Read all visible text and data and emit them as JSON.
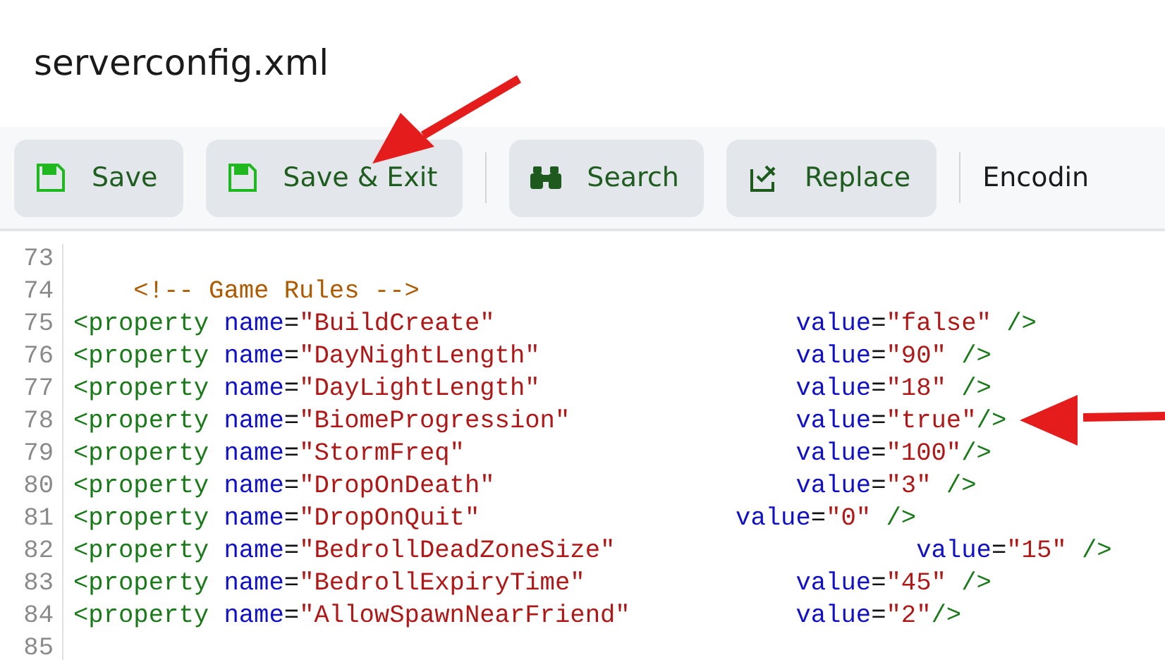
{
  "window": {
    "title": "serverconfig.xml"
  },
  "toolbar": {
    "buttons": [
      {
        "kind": "save",
        "label": "Save"
      },
      {
        "kind": "save",
        "label": "Save & Exit"
      },
      {
        "kind": "separator"
      },
      {
        "kind": "search",
        "label": "Search"
      },
      {
        "kind": "replace",
        "label": "Replace"
      },
      {
        "kind": "separator"
      },
      {
        "kind": "text",
        "label": "Encodin"
      }
    ]
  },
  "editor": {
    "lines": [
      {
        "number": "73"
      },
      {
        "number": "74",
        "tokens": [
          {
            "kind": "comment",
            "text": "    <!-- Game Rules -->"
          }
        ]
      },
      {
        "number": "75",
        "tokens": [
          {
            "kind": "tag",
            "text": "<property"
          },
          {
            "kind": "attr",
            "text": " name"
          },
          {
            "kind": "punct",
            "text": "="
          },
          {
            "kind": "string",
            "text": "\"BuildCreate\""
          },
          {
            "kind": "attr",
            "text": "                    value"
          },
          {
            "kind": "punct",
            "text": "="
          },
          {
            "kind": "string",
            "text": "\"false\""
          },
          {
            "kind": "tag",
            "text": " />"
          }
        ]
      },
      {
        "number": "76",
        "tokens": [
          {
            "kind": "tag",
            "text": "<property"
          },
          {
            "kind": "attr",
            "text": " name"
          },
          {
            "kind": "punct",
            "text": "="
          },
          {
            "kind": "string",
            "text": "\"DayNightLength\""
          },
          {
            "kind": "attr",
            "text": "                 value"
          },
          {
            "kind": "punct",
            "text": "="
          },
          {
            "kind": "string",
            "text": "\"90\""
          },
          {
            "kind": "tag",
            "text": " />"
          }
        ]
      },
      {
        "number": "77",
        "tokens": [
          {
            "kind": "tag",
            "text": "<property"
          },
          {
            "kind": "attr",
            "text": " name"
          },
          {
            "kind": "punct",
            "text": "="
          },
          {
            "kind": "string",
            "text": "\"DayLightLength\""
          },
          {
            "kind": "attr",
            "text": "                 value"
          },
          {
            "kind": "punct",
            "text": "="
          },
          {
            "kind": "string",
            "text": "\"18\""
          },
          {
            "kind": "tag",
            "text": " />"
          }
        ]
      },
      {
        "number": "78",
        "tokens": [
          {
            "kind": "tag",
            "text": "<property"
          },
          {
            "kind": "attr",
            "text": " name"
          },
          {
            "kind": "punct",
            "text": "="
          },
          {
            "kind": "string",
            "text": "\"BiomeProgression\""
          },
          {
            "kind": "attr",
            "text": "               value"
          },
          {
            "kind": "punct",
            "text": "="
          },
          {
            "kind": "string",
            "text": "\"true\""
          },
          {
            "kind": "tag",
            "text": "/>"
          }
        ]
      },
      {
        "number": "79",
        "tokens": [
          {
            "kind": "tag",
            "text": "<property"
          },
          {
            "kind": "attr",
            "text": " name"
          },
          {
            "kind": "punct",
            "text": "="
          },
          {
            "kind": "string",
            "text": "\"StormFreq\""
          },
          {
            "kind": "attr",
            "text": "                      value"
          },
          {
            "kind": "punct",
            "text": "="
          },
          {
            "kind": "string",
            "text": "\"100\""
          },
          {
            "kind": "tag",
            "text": "/>"
          }
        ]
      },
      {
        "number": "80",
        "tokens": [
          {
            "kind": "tag",
            "text": "<property"
          },
          {
            "kind": "attr",
            "text": " name"
          },
          {
            "kind": "punct",
            "text": "="
          },
          {
            "kind": "string",
            "text": "\"DropOnDeath\""
          },
          {
            "kind": "attr",
            "text": "                    value"
          },
          {
            "kind": "punct",
            "text": "="
          },
          {
            "kind": "string",
            "text": "\"3\""
          },
          {
            "kind": "tag",
            "text": " />"
          }
        ]
      },
      {
        "number": "81",
        "tokens": [
          {
            "kind": "tag",
            "text": "<property"
          },
          {
            "kind": "attr",
            "text": " name"
          },
          {
            "kind": "punct",
            "text": "="
          },
          {
            "kind": "string",
            "text": "\"DropOnQuit\""
          },
          {
            "kind": "attr",
            "text": "                 value"
          },
          {
            "kind": "punct",
            "text": "="
          },
          {
            "kind": "string",
            "text": "\"0\""
          },
          {
            "kind": "tag",
            "text": " />"
          }
        ]
      },
      {
        "number": "82",
        "tokens": [
          {
            "kind": "tag",
            "text": "<property"
          },
          {
            "kind": "attr",
            "text": " name"
          },
          {
            "kind": "punct",
            "text": "="
          },
          {
            "kind": "string",
            "text": "\"BedrollDeadZoneSize\""
          },
          {
            "kind": "attr",
            "text": "                    value"
          },
          {
            "kind": "punct",
            "text": "="
          },
          {
            "kind": "string",
            "text": "\"15\""
          },
          {
            "kind": "tag",
            "text": " />"
          }
        ]
      },
      {
        "number": "83",
        "tokens": [
          {
            "kind": "tag",
            "text": "<property"
          },
          {
            "kind": "attr",
            "text": " name"
          },
          {
            "kind": "punct",
            "text": "="
          },
          {
            "kind": "string",
            "text": "\"BedrollExpiryTime\""
          },
          {
            "kind": "attr",
            "text": "              value"
          },
          {
            "kind": "punct",
            "text": "="
          },
          {
            "kind": "string",
            "text": "\"45\""
          },
          {
            "kind": "tag",
            "text": " />"
          }
        ]
      },
      {
        "number": "84",
        "tokens": [
          {
            "kind": "tag",
            "text": "<property"
          },
          {
            "kind": "attr",
            "text": " name"
          },
          {
            "kind": "punct",
            "text": "="
          },
          {
            "kind": "string",
            "text": "\"AllowSpawnNearFriend\""
          },
          {
            "kind": "attr",
            "text": "           value"
          },
          {
            "kind": "punct",
            "text": "="
          },
          {
            "kind": "string",
            "text": "\"2\""
          },
          {
            "kind": "tag",
            "text": "/>"
          }
        ]
      },
      {
        "number": "85"
      }
    ]
  }
}
